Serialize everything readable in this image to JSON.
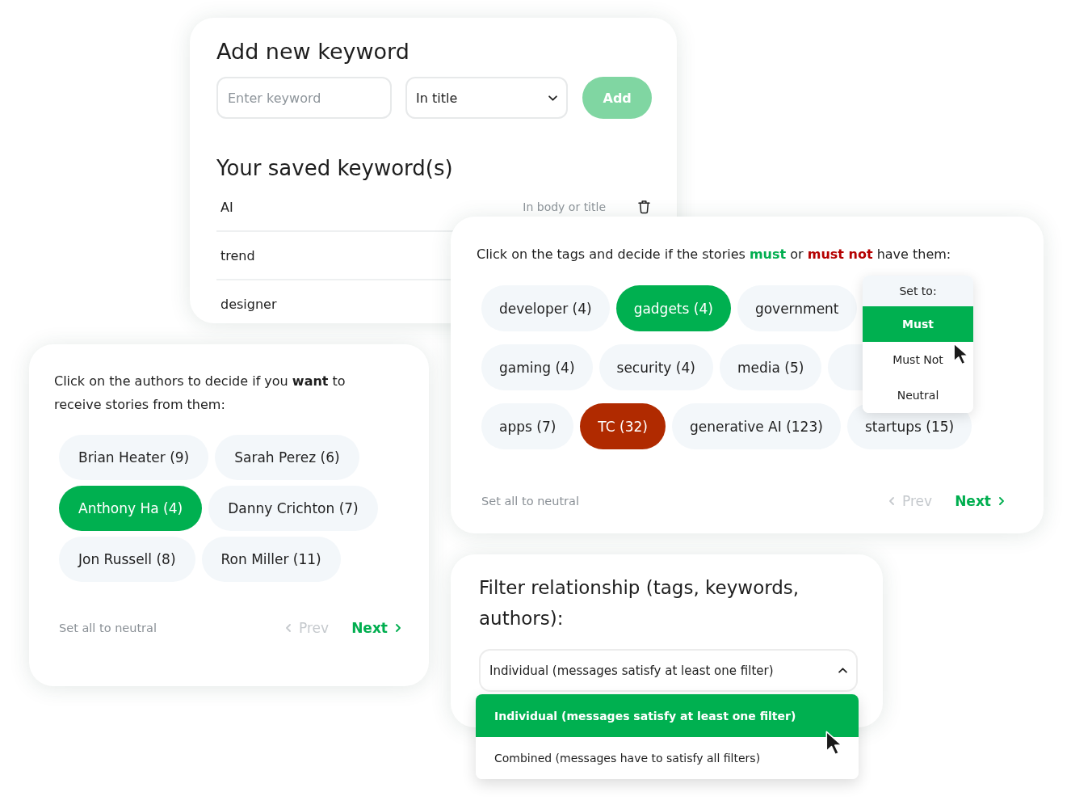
{
  "keyword_card": {
    "title": "Add new keyword",
    "keyword_input": {
      "placeholder": "Enter keyword"
    },
    "location_select": {
      "value": "In title"
    },
    "add_button": {
      "label": "Add",
      "disabled": true
    },
    "saved_title": "Your saved keyword(s)",
    "saved_keywords": [
      {
        "keyword": "AI",
        "location": "In body or title"
      },
      {
        "keyword": "trend"
      },
      {
        "keyword": "designer"
      }
    ]
  },
  "tags_card": {
    "prompt": [
      {
        "kind": "plain",
        "text": "Click on the tags and decide if the stories "
      },
      {
        "kind": "must",
        "text": "must"
      },
      {
        "kind": "plain",
        "text": " or "
      },
      {
        "kind": "must_not",
        "text": "must not"
      },
      {
        "kind": "plain",
        "text": " have them:"
      }
    ],
    "tag_rows": [
      [
        {
          "label": "developer (4)",
          "must": false,
          "must_not": false
        },
        {
          "label": "gadgets (4)",
          "must": true,
          "must_not": false
        },
        {
          "label": "government",
          "must": false,
          "must_not": false
        }
      ],
      [
        {
          "label": "gaming (4)",
          "must": false,
          "must_not": false
        },
        {
          "label": "security (4)",
          "must": false,
          "must_not": false
        },
        {
          "label": "media (5)",
          "must": false,
          "must_not": false
        },
        {
          "must": false,
          "must_not": false
        }
      ],
      [
        {
          "label": "apps (7)",
          "must": false,
          "must_not": false
        },
        {
          "label": "TC (32)",
          "must": false,
          "must_not": true
        },
        {
          "label": "generative AI (123)",
          "must": false,
          "must_not": false
        },
        {
          "label": "startups (15)",
          "must": false,
          "must_not": false
        }
      ]
    ],
    "state_menu": {
      "title": "Set to:",
      "options": [
        {
          "label": "Must",
          "selected": true
        },
        {
          "label": "Must Not",
          "selected": false
        },
        {
          "label": "Neutral",
          "selected": false
        }
      ]
    },
    "footer": {
      "reset": "Set all to neutral",
      "prev": {
        "label": "Prev",
        "disabled": true
      },
      "next": {
        "label": "Next",
        "disabled": false
      }
    }
  },
  "authors_card": {
    "prompt": "Click on the authors to decide if you **want** to receive stories from them:",
    "author_rows": [
      [
        {
          "label": "Brian Heater (9)",
          "selected": false
        },
        {
          "label": "Sarah Perez (6)",
          "selected": false
        }
      ],
      [
        {
          "label": "Anthony Ha (4)",
          "selected": true
        },
        {
          "label": "Danny Crichton (7)",
          "selected": false
        }
      ],
      [
        {
          "label": "Jon Russell (8)",
          "selected": false
        },
        {
          "label": "Ron Miller (11)",
          "selected": false
        }
      ]
    ],
    "footer": {
      "reset": "Set all to neutral",
      "prev": {
        "label": "Prev",
        "disabled": true
      },
      "next": {
        "label": "Next",
        "disabled": false
      }
    }
  },
  "filter_card": {
    "title": "Filter relationship (tags, keywords, authors):",
    "select": {
      "value": "Individual (messages satisfy at least one filter)",
      "expanded": true,
      "options": [
        {
          "label": "Individual (messages satisfy at least one filter)",
          "selected": true
        },
        {
          "label": "Combined (messages have to satisfy all filters)",
          "selected": false
        }
      ]
    }
  }
}
